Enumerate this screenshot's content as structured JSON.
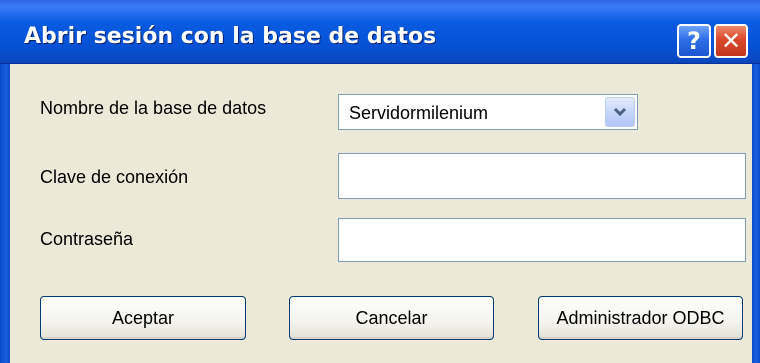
{
  "window": {
    "title": "Abrir sesión con la base de datos",
    "help_glyph": "?",
    "close_glyph": "✕"
  },
  "form": {
    "database_label": "Nombre de la base de datos",
    "database_value": "Servidormilenium",
    "dropdown_glyph": "⌄",
    "connection_key_label": "Clave de conexión",
    "connection_key_value": "",
    "password_label": "Contraseña",
    "password_value": ""
  },
  "buttons": {
    "ok_label": "Aceptar",
    "cancel_label": "Cancelar",
    "odbc_label": "Administrador ODBC"
  },
  "colors": {
    "titlebar": "#0552d6",
    "dialog_background": "#ece9d8",
    "close_button": "#d9482a",
    "help_button": "#2f6fe6",
    "field_border": "#7f9db9",
    "button_border": "#003c74"
  },
  "icons": {
    "help": "help-icon",
    "close": "close-icon",
    "dropdown": "chevron-down-icon"
  }
}
